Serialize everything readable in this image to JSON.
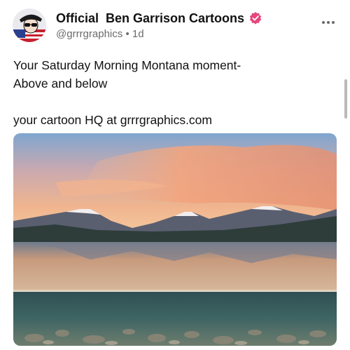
{
  "post": {
    "author": {
      "display_name": "Official  Ben Garrison Cartoons",
      "handle": "@grrrgraphics",
      "separator": "•",
      "time": "1d",
      "verified_badge": "verified-badge-icon",
      "verified_color": "#e5467e"
    },
    "body_lines": [
      "Your Saturday Morning Montana moment-",
      "Above and below",
      "",
      "your cartoon HQ at grrrgraphics.com"
    ],
    "more_menu_icon": "more-horizontal-icon",
    "media": {
      "type": "photo",
      "icon": "landscape-photo"
    }
  }
}
